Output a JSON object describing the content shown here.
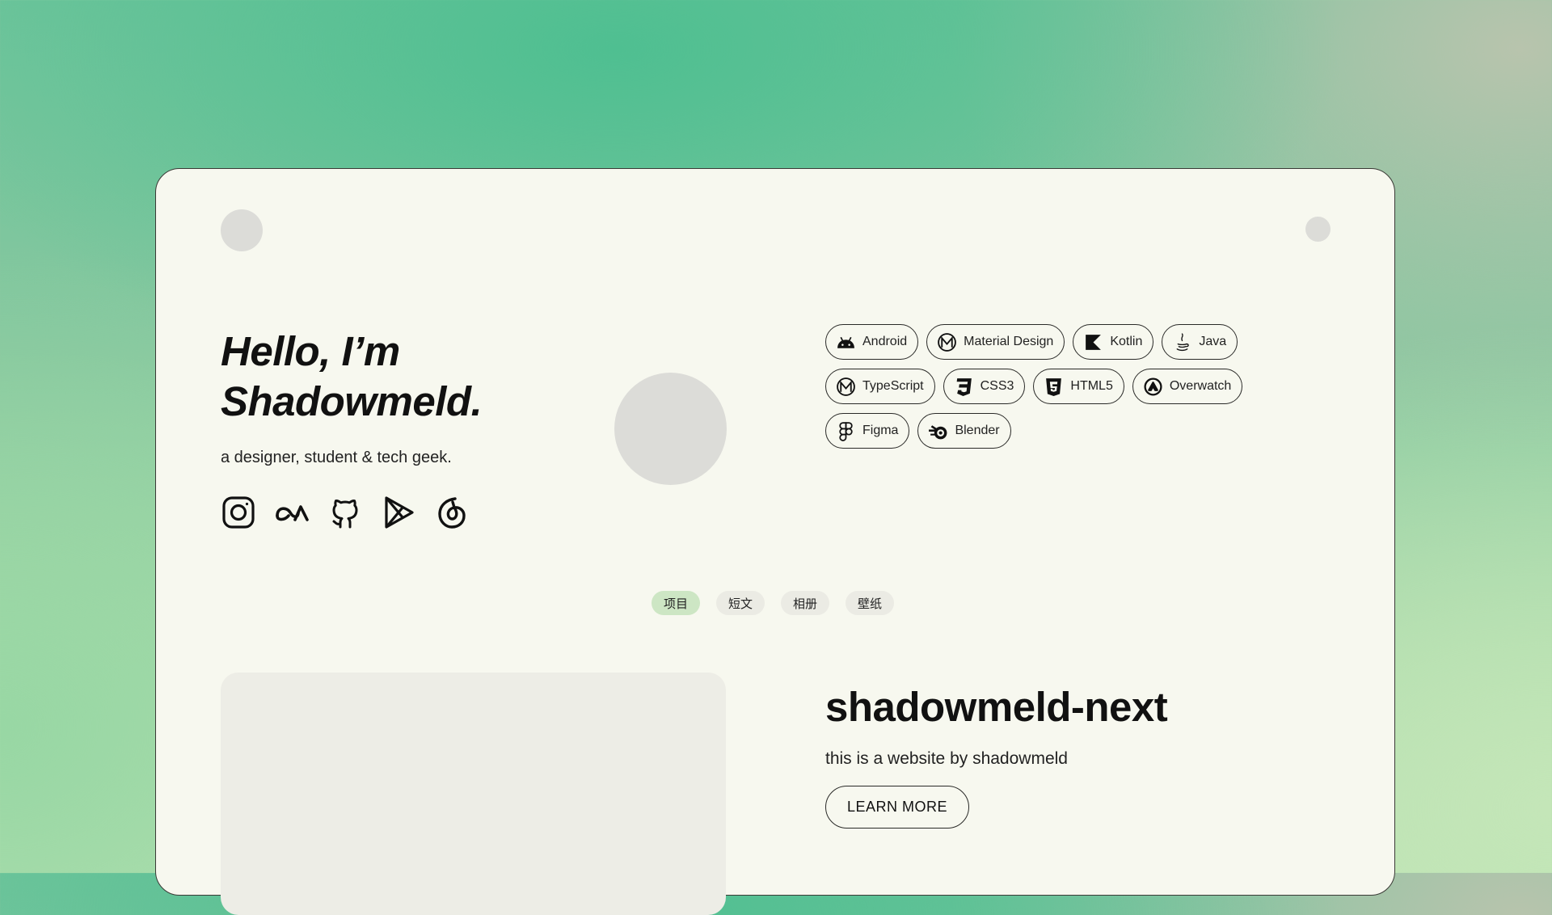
{
  "hero": {
    "title_line1": "Hello, I’m",
    "title_line2": "Shadowmeld.",
    "subtitle": "a designer, student & tech geek."
  },
  "socials": [
    {
      "icon": "instagram-icon"
    },
    {
      "icon": "osu-icon"
    },
    {
      "icon": "github-icon"
    },
    {
      "icon": "google-play-icon"
    },
    {
      "icon": "netease-music-icon"
    }
  ],
  "skills": [
    {
      "label": "Android",
      "icon": "android-icon"
    },
    {
      "label": "Material Design",
      "icon": "material-design-icon"
    },
    {
      "label": "Kotlin",
      "icon": "kotlin-icon"
    },
    {
      "label": "Java",
      "icon": "java-icon"
    },
    {
      "label": "TypeScript",
      "icon": "typescript-icon"
    },
    {
      "label": "CSS3",
      "icon": "css3-icon"
    },
    {
      "label": "HTML5",
      "icon": "html5-icon"
    },
    {
      "label": "Overwatch",
      "icon": "overwatch-icon"
    },
    {
      "label": "Figma",
      "icon": "figma-icon"
    },
    {
      "label": "Blender",
      "icon": "blender-icon"
    }
  ],
  "tabs": [
    {
      "label": "项目",
      "active": true
    },
    {
      "label": "短文",
      "active": false
    },
    {
      "label": "相册",
      "active": false
    },
    {
      "label": "壁纸",
      "active": false
    }
  ],
  "project": {
    "title": "shadowmeld-next",
    "description": "this is a website by shadowmeld",
    "button_label": "LEARN MORE"
  },
  "colors": {
    "card_background": "#f7f8ef",
    "active_tab": "#cde6c4",
    "tab": "#ebebe4",
    "placeholder": "#dcdcd8"
  }
}
